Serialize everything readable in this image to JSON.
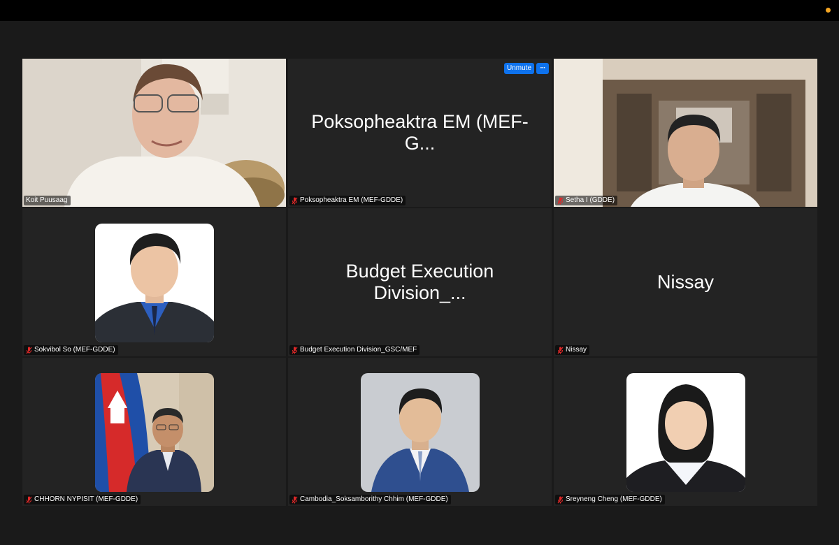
{
  "window": {
    "notification_dot_color": "#f5a623"
  },
  "controls": {
    "unmute_label": "Unmute",
    "more_label": "···"
  },
  "participants": [
    {
      "name": "Koit Puusaag",
      "big_label": "",
      "muted": false,
      "video": true,
      "active": true
    },
    {
      "name": "Poksopheaktra EM (MEF-GDDE)",
      "big_label": "Poksopheaktra EM (MEF-G...",
      "muted": true,
      "video": false
    },
    {
      "name": "Setha I (GDDE)",
      "big_label": "",
      "muted": true,
      "video": true
    },
    {
      "name": "Sokvibol So (MEF-GDDE)",
      "big_label": "",
      "muted": true,
      "video": false,
      "photo": true
    },
    {
      "name": "Budget Execution Division_GSC/MEF",
      "big_label": "Budget Execution Division_...",
      "muted": true,
      "video": false
    },
    {
      "name": "Nissay",
      "big_label": "Nissay",
      "muted": true,
      "video": false
    },
    {
      "name": "CHHORN NYPISIT (MEF-GDDE)",
      "big_label": "",
      "muted": true,
      "video": false,
      "photo": true
    },
    {
      "name": "Cambodia_Soksamborithy Chhim (MEF-GDDE)",
      "big_label": "",
      "muted": true,
      "video": false,
      "photo": true
    },
    {
      "name": "Sreyneng Cheng (MEF-GDDE)",
      "big_label": "",
      "muted": true,
      "video": false,
      "photo": true
    }
  ],
  "colors": {
    "active_speaker": "#2fb84a",
    "button": "#0e72ed",
    "muted_icon": "#e02828"
  }
}
